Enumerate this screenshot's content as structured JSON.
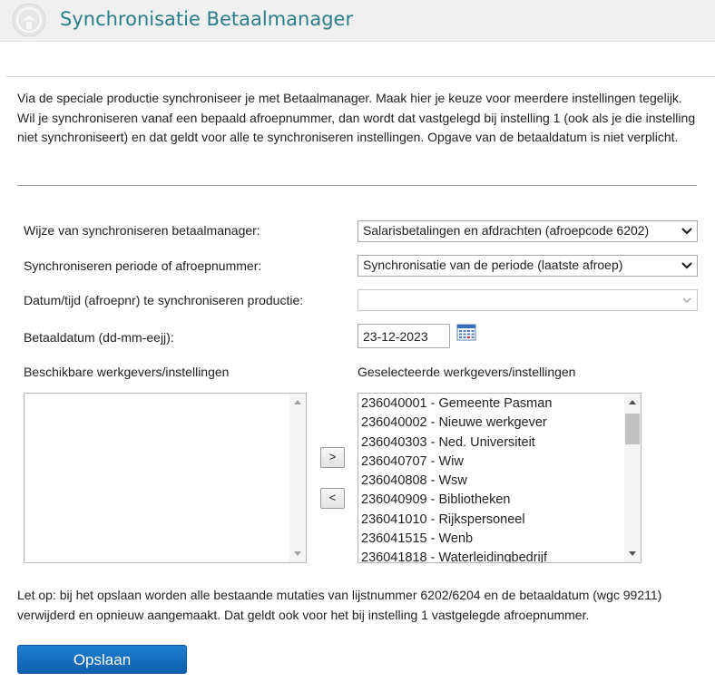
{
  "header": {
    "title": "Synchronisatie Betaalmanager",
    "logo_icon": "emblem-logo"
  },
  "intro_text": "Via de speciale productie synchroniseer je met Betaalmanager. Maak hier je keuze voor meerdere instellingen tegelijk. Wil je synchroniseren vanaf een bepaald afroepnummer, dan wordt dat vastgelegd bij instelling 1 (ook als je die instelling niet synchroniseert) en dat geldt voor alle te synchroniseren instellingen. Opgave van de betaaldatum is niet verplicht.",
  "form": {
    "wijze": {
      "label": "Wijze van synchroniseren betaalmanager:",
      "value": "Salarisbetalingen en afdrachten (afroepcode 6202)"
    },
    "periode": {
      "label": "Synchroniseren periode of afroepnummer:",
      "value": "Synchronisatie van de periode (laatste afroep)"
    },
    "datumtijd": {
      "label": "Datum/tijd (afroepnr) te synchroniseren productie:",
      "value": ""
    },
    "betaaldatum": {
      "label": "Betaaldatum (dd-mm-eejj):",
      "value": "23-12-2023",
      "icon": "calendar-icon"
    }
  },
  "lists": {
    "available": {
      "label": "Beschikbare werkgevers/instellingen",
      "items": []
    },
    "selected": {
      "label": "Geselecteerde werkgevers/instellingen",
      "items": [
        "236040001 - Gemeente Pasman",
        "236040002 - Nieuwe werkgever",
        "236040303 - Ned. Universiteit",
        "236040707 - Wiw",
        "236040808 - Wsw",
        "236040909 - Bibliotheken",
        "236041010 - Rijkspersoneel",
        "236041515 - Wenb",
        "236041818 - Waterleidingbedrijf"
      ]
    },
    "move_right_label": ">",
    "move_left_label": "<"
  },
  "note_text": "Let op: bij het opslaan worden alle bestaande mutaties van lijstnummer 6202/6204 en de betaaldatum (wgc 99211) verwijderd en opnieuw aangemaakt. Dat geldt ook voor het bij instelling 1 vastgelegde afroepnummer.",
  "save_label": "Opslaan",
  "colors": {
    "title": "#2a7d8c",
    "save_button": "#1a73c6"
  }
}
